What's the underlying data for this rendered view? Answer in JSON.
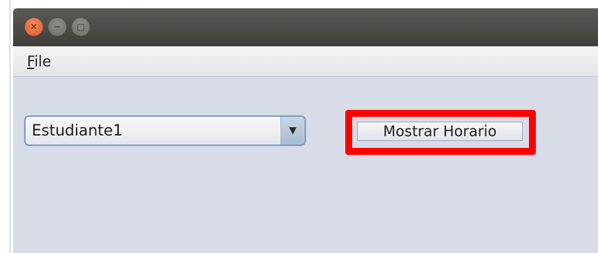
{
  "window": {
    "controls": {
      "close_icon": "close-icon",
      "minimize_icon": "minimize-icon",
      "maximize_icon": "maximize-icon"
    }
  },
  "menubar": {
    "file_mnemonic": "F",
    "file_rest": "ile"
  },
  "main": {
    "student_select": {
      "selected_value": "Estudiante1",
      "arrow_icon": "chevron-down-icon"
    },
    "show_schedule_button": {
      "label": "Mostrar Horario",
      "highlight_color": "#ff0000"
    }
  }
}
